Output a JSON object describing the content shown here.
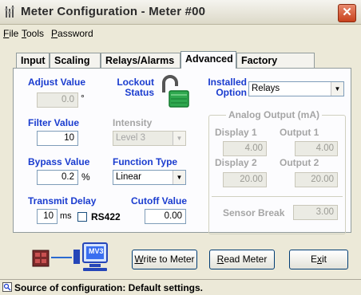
{
  "window": {
    "title": "Meter Configuration - Meter #00",
    "close": "✕"
  },
  "menu": [
    {
      "key": "F",
      "rest": "ile"
    },
    {
      "key": "T",
      "rest": "ools"
    },
    {
      "key": "P",
      "rest": "assword"
    }
  ],
  "tabs": [
    "Input",
    "Scaling",
    "Relays/Alarms",
    "Advanced",
    "Factory Values"
  ],
  "active_tab": "Advanced",
  "adjust": {
    "label": "Adjust Value",
    "value": "0.0",
    "unit": "°"
  },
  "lockout": {
    "label1": "Lockout",
    "label2": "Status"
  },
  "installed": {
    "label1": "Installed",
    "label2": "Option",
    "value": "Relays"
  },
  "filter": {
    "label": "Filter Value",
    "value": "10"
  },
  "intensity": {
    "label": "Intensity",
    "value": "Level 3"
  },
  "analog": {
    "title": "Analog Output (mA)",
    "display1_label": "Display 1",
    "display1_value": "4.00",
    "output1_label": "Output 1",
    "output1_value": "4.00",
    "display2_label": "Display 2",
    "display2_value": "20.00",
    "output2_label": "Output 2",
    "output2_value": "20.00",
    "sensor_break_label": "Sensor Break",
    "sensor_break_value": "3.00"
  },
  "bypass": {
    "label": "Bypass Value",
    "value": "0.2",
    "unit": "%"
  },
  "function_type": {
    "label": "Function Type",
    "value": "Linear"
  },
  "transmit": {
    "label": "Transmit Delay",
    "value": "10",
    "unit": "ms",
    "rs422_label": "RS422"
  },
  "cutoff": {
    "label": "Cutoff Value",
    "value": "0.00"
  },
  "buttons": {
    "write_key": "W",
    "write_rest": "rite to Meter",
    "read_key": "R",
    "read_rest": "ead Meter",
    "exit_pre": "E",
    "exit_key": "x",
    "exit_rest": "it"
  },
  "device_label": "MV3",
  "status": "Source of configuration: Default settings.",
  "colors": {
    "label_blue": "#1a3ccf",
    "accent_green": "#20a040"
  }
}
